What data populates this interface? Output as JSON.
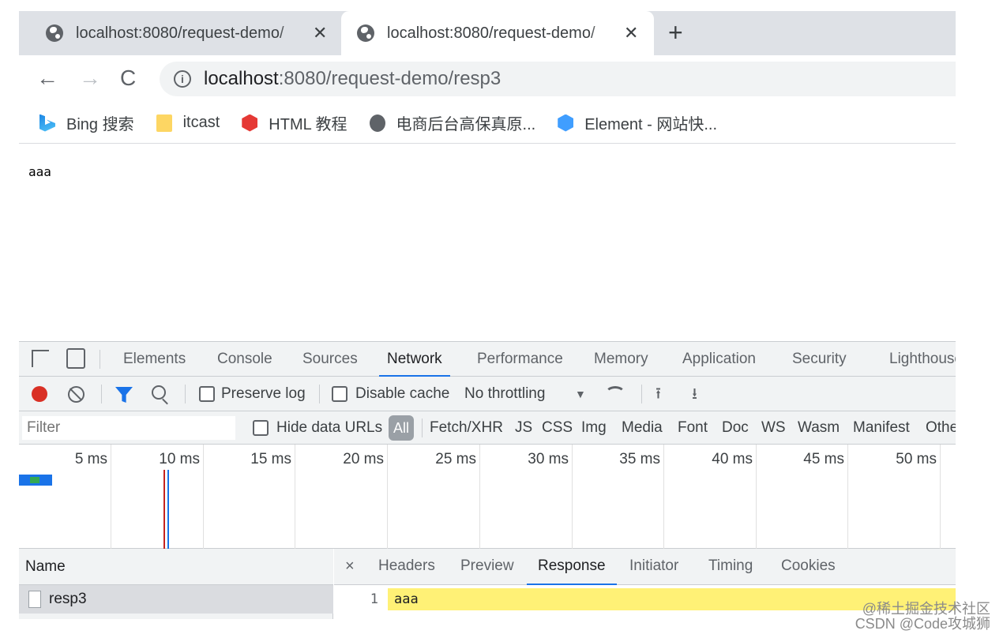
{
  "tabs": [
    {
      "title": "localhost:8080/request-demo/",
      "close": "✕"
    },
    {
      "title": "localhost:8080/request-demo/",
      "close": "✕"
    }
  ],
  "new_tab_icon": "+",
  "nav": {
    "back": "←",
    "forward": "→",
    "reload": "C"
  },
  "address": {
    "host": "localhost",
    "rest": ":8080/request-demo/resp3",
    "info_icon": "i"
  },
  "bookmarks": [
    {
      "label": "Bing 搜索",
      "icon": "bing-icon"
    },
    {
      "label": "itcast",
      "icon": "folder-icon"
    },
    {
      "label": "HTML 教程",
      "icon": "html-icon"
    },
    {
      "label": "电商后台高保真原...",
      "icon": "globe-icon"
    },
    {
      "label": "Element - 网站快...",
      "icon": "element-icon"
    }
  ],
  "page": {
    "body_text": "aaa"
  },
  "devtools": {
    "tabs": [
      "Elements",
      "Console",
      "Sources",
      "Network",
      "Performance",
      "Memory",
      "Application",
      "Security",
      "Lighthouse"
    ],
    "active_tab": "Network",
    "toolbar": {
      "preserve_log": "Preserve log",
      "disable_cache": "Disable cache",
      "throttling": "No throttling",
      "caret": "▼",
      "upload": "⭱",
      "download": "⭳"
    },
    "filter": {
      "placeholder": "Filter",
      "hide_data_urls": "Hide data URLs",
      "all": "All",
      "types": [
        "Fetch/XHR",
        "JS",
        "CSS",
        "Img",
        "Media",
        "Font",
        "Doc",
        "WS",
        "Wasm",
        "Manifest",
        "Other"
      ]
    },
    "timeline": {
      "ticks": [
        "5 ms",
        "10 ms",
        "15 ms",
        "20 ms",
        "25 ms",
        "30 ms",
        "35 ms",
        "40 ms",
        "45 ms",
        "50 ms"
      ]
    },
    "requests": {
      "header": "Name",
      "rows": [
        {
          "name": "resp3"
        }
      ]
    },
    "detail": {
      "close": "×",
      "tabs": [
        "Headers",
        "Preview",
        "Response",
        "Initiator",
        "Timing",
        "Cookies"
      ],
      "active_tab": "Response",
      "response": {
        "line_number": "1",
        "text": "aaa"
      }
    }
  },
  "watermark": {
    "line1": "@稀土掘金技术社区",
    "line2": "CSDN @Code攻城狮"
  },
  "colors": {
    "accent": "#1a73e8",
    "record": "#d93025",
    "highlight": "#fff176"
  }
}
